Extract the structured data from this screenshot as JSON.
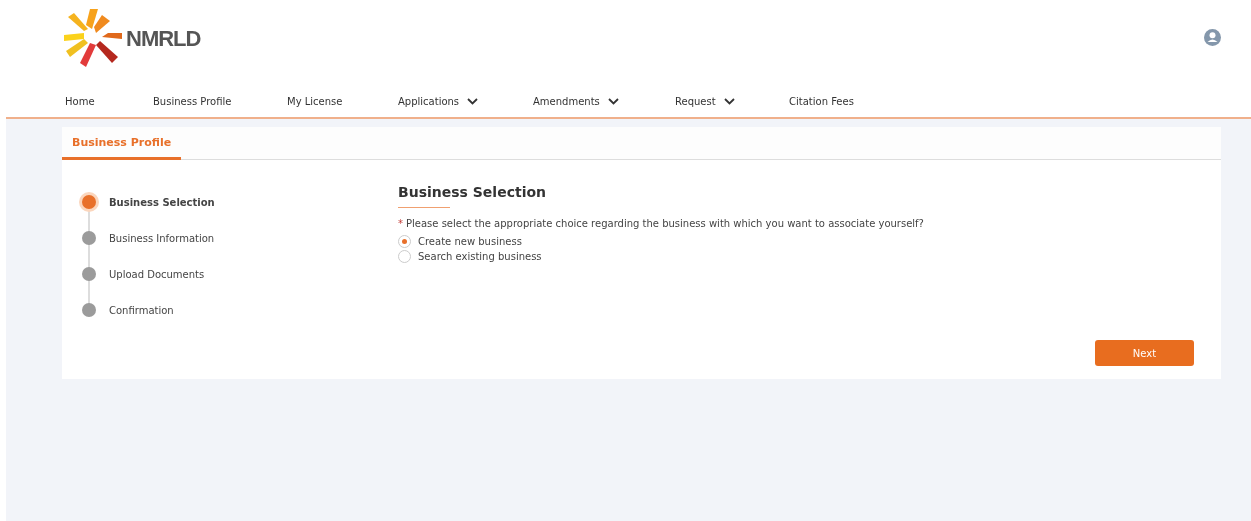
{
  "header": {
    "logo_text": "NMRLD"
  },
  "nav": [
    {
      "label": "Home",
      "dropdown": false
    },
    {
      "label": "Business Profile",
      "dropdown": false
    },
    {
      "label": "My License",
      "dropdown": false
    },
    {
      "label": "Applications",
      "dropdown": true
    },
    {
      "label": "Amendments",
      "dropdown": true
    },
    {
      "label": "Request",
      "dropdown": true
    },
    {
      "label": "Citation Fees",
      "dropdown": false
    }
  ],
  "tabs": [
    {
      "label": "Business Profile",
      "selected": true
    }
  ],
  "steps": [
    {
      "label": "Business Selection",
      "selected": true
    },
    {
      "label": "Business Information",
      "selected": false
    },
    {
      "label": "Upload Documents",
      "selected": false
    },
    {
      "label": "Confirmation",
      "selected": false
    }
  ],
  "form": {
    "title": "Business Selection",
    "required_mark": "*",
    "question": "Please select the appropriate choice regarding the business with which you want to associate yourself?",
    "options": [
      {
        "label": "Create new business",
        "selected": true
      },
      {
        "label": "Search existing business",
        "selected": false
      }
    ]
  },
  "buttons": [
    {
      "label": "Next"
    }
  ]
}
